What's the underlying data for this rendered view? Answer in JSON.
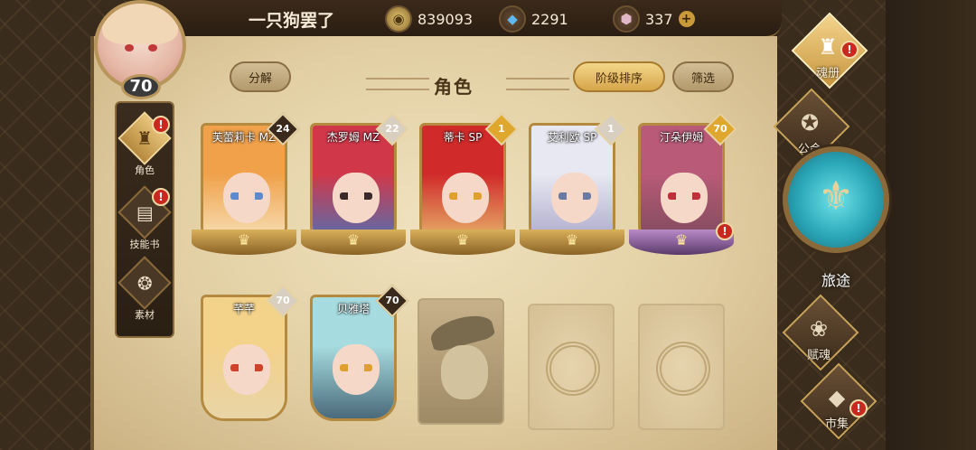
{
  "header": {
    "player_name": "一只狗罢了",
    "title": "角色"
  },
  "resources": {
    "gold": "839093",
    "crystal": "2291",
    "gem": "337",
    "gem_add": "+"
  },
  "avatar": {
    "level": "70"
  },
  "left_nav": [
    {
      "label": "角色",
      "icon": "helmet-icon",
      "glyph": "♜",
      "alert": "!"
    },
    {
      "label": "技能书",
      "icon": "book-icon",
      "glyph": "▤",
      "alert": "!"
    },
    {
      "label": "素材",
      "icon": "crest-icon",
      "glyph": "❂",
      "alert": ""
    }
  ],
  "toolbar": {
    "decompose": "分解",
    "sort": "阶级排序",
    "filter": "筛选"
  },
  "cards": [
    {
      "name": "芙蕾莉卡 MZ",
      "level": "24",
      "hair": "#f0a14a",
      "eye": "#5a8ad0",
      "bg": "#f7e6c0",
      "badge": "#3a2a1c"
    },
    {
      "name": "杰罗姆 MZ",
      "level": "22",
      "hair": "#d0384a",
      "eye": "#3a2a2a",
      "bg": "#4a74b8",
      "badge": "#d8cfc0"
    },
    {
      "name": "蒂卡 SP",
      "level": "1",
      "hair": "#d02a2a",
      "eye": "#e0a030",
      "bg": "#e8c070",
      "badge": "#e0a72e"
    },
    {
      "name": "艾利欧 SP",
      "level": "1",
      "hair": "#e8e8f2",
      "eye": "#6a7aa0",
      "bg": "#a8a4c8",
      "badge": "#d8cfc0"
    },
    {
      "name": "汀朵伊姆",
      "level": "70",
      "hair": "#b85a78",
      "eye": "#c0303a",
      "bg": "#7a4a5a",
      "badge": "#e0a72e",
      "alert": "!"
    },
    {
      "name": "芊芊",
      "level": "70",
      "hair": "#f3d28a",
      "eye": "#d0402a",
      "bg": "#e8d4a6",
      "badge": "#d8cfc0"
    },
    {
      "name": "贝雅塔",
      "level": "70",
      "hair": "#a6dce0",
      "eye": "#e0a030",
      "bg": "#4a6a7a",
      "badge": "#3a2a1c"
    }
  ],
  "right_nav": {
    "soul_book": {
      "label": "魂册",
      "icon": "soul-book-icon",
      "glyph": "♜",
      "alert": "!"
    },
    "guild": {
      "label": "公会",
      "icon": "guild-icon",
      "glyph": "✪"
    },
    "journey": {
      "label": "旅途",
      "icon": "journey-icon",
      "glyph": "⚜"
    },
    "soul_gift": {
      "label": "赋魂",
      "icon": "swirl-icon",
      "glyph": "❀"
    },
    "market": {
      "label": "市集",
      "icon": "gem-icon",
      "glyph": "◆",
      "alert": "!"
    }
  },
  "colors": {
    "accent_gold": "#d6a64a",
    "alert_red": "#c8281e",
    "panel": "#e2cfa3"
  }
}
